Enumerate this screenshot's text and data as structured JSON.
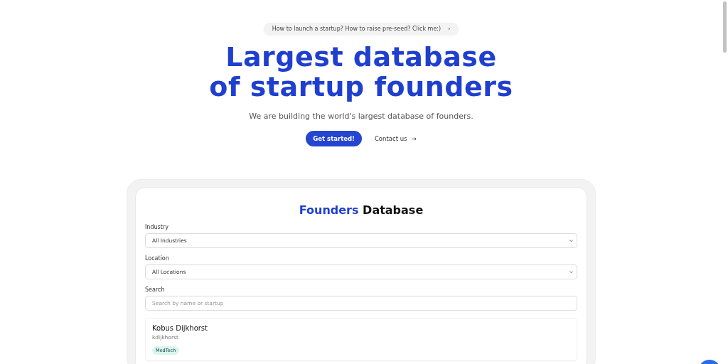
{
  "announcement": {
    "text": "How to launch a startup? How to raise pre-seed? Click me:)",
    "chevron": "›"
  },
  "hero": {
    "title_lines": [
      "Largest database",
      "of startup founders"
    ],
    "subtitle": "We are building the world's largest database of founders.",
    "primary_button": "Get started!",
    "secondary_link": "Contact us",
    "secondary_arrow": "→"
  },
  "database": {
    "title_highlight": "Founders",
    "title_rest": "Database",
    "filters": [
      {
        "kind": "select",
        "label": "Industry",
        "value": "All Industries"
      },
      {
        "kind": "select",
        "label": "Location",
        "value": "All Locations"
      },
      {
        "kind": "search",
        "label": "Search",
        "placeholder": "Search by name or startup"
      }
    ],
    "founders": [
      {
        "name": "Kobus Dijkhorst",
        "handle": "kdijkhorst",
        "tags": [
          "MedTech"
        ]
      }
    ]
  }
}
